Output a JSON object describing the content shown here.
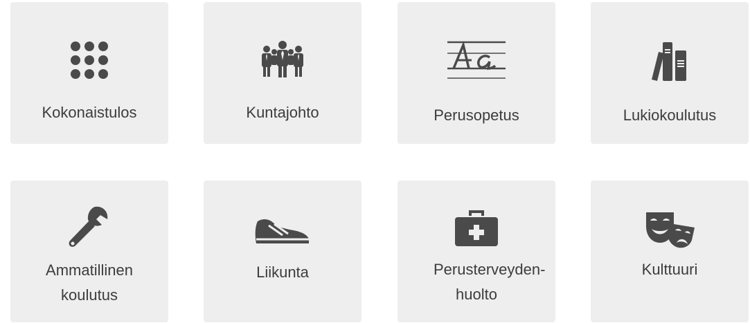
{
  "tiles": [
    {
      "label": "Kokonaistulos",
      "icon": "dots-grid-icon"
    },
    {
      "label": "Kuntajohto",
      "icon": "people-group-icon"
    },
    {
      "label": "Perusopetus",
      "icon": "handwriting-letters-icon"
    },
    {
      "label": "Lukiokoulutus",
      "icon": "books-icon"
    },
    {
      "label": "Ammatillinen koulutus",
      "icon": "wrench-icon"
    },
    {
      "label": "Liikunta",
      "icon": "running-shoe-icon"
    },
    {
      "label": "Perusterveyden-huolto",
      "icon": "first-aid-kit-icon"
    },
    {
      "label": "Kulttuuri",
      "icon": "theater-masks-icon"
    }
  ],
  "colors": {
    "tile_background": "#eeeeee",
    "icon": "#4a4a4a",
    "text": "#3c3c3c"
  }
}
